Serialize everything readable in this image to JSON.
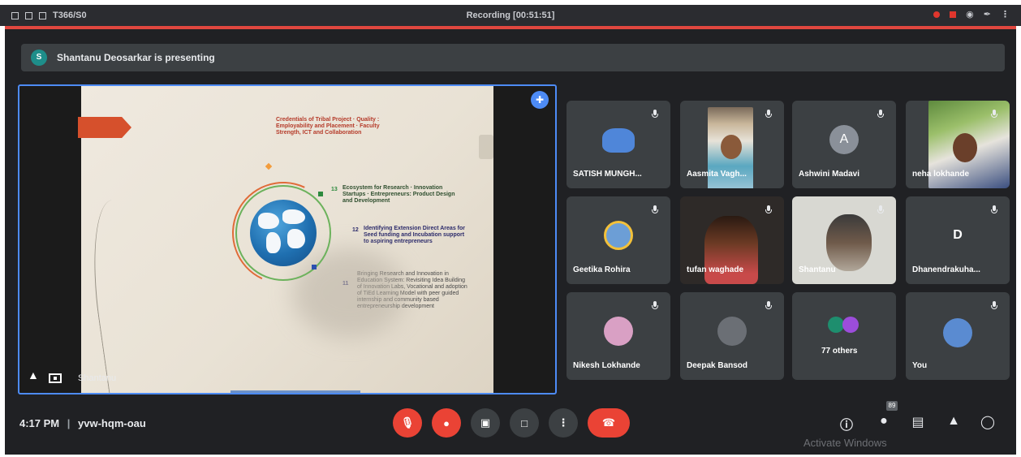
{
  "window": {
    "title": "T366/S0",
    "recording": "Recording [00:51:51]"
  },
  "banner": {
    "avatar_initial": "S",
    "text": "Shantanu Deosarkar is presenting"
  },
  "presentation": {
    "slide": {
      "block1": "Credentials of Tribal Project · Quality : Employability and Placement · Faculty Strength, ICT and Collaboration",
      "block2": "Ecosystem for Research · Innovation Startups · Entrepreneurs: Product Design and Development",
      "block3": "Identifying Extension Direct Areas for Seed funding and Incubation support to aspiring entrepreneurs",
      "block4": "Bringing Research and Innovation in Education System: Revisiting Idea Building of Innovation Labs, Vocational and adoption of TiEd Learning Model with peer guided internship and community based entrepreneurship development",
      "num2": "13",
      "num3": "12",
      "num4": "11"
    },
    "label": "Shantanu",
    "expand_icon": "expand-icon"
  },
  "participants": [
    {
      "name": "SATISH MUNGH...",
      "type": "avatar",
      "color": "#4f86d9"
    },
    {
      "name": "Aasmita Vagh...",
      "type": "video"
    },
    {
      "name": "Ashwini Madavi",
      "type": "initial",
      "initial": "A",
      "color": "#8a9099"
    },
    {
      "name": "neha lokhande",
      "type": "video"
    },
    {
      "name": "Geetika Rohira",
      "type": "avatar",
      "color": "#6c9ed6"
    },
    {
      "name": "tufan waghade",
      "type": "video"
    },
    {
      "name": "Shantanu",
      "type": "video"
    },
    {
      "name": "Dhanendrakuha...",
      "type": "initial",
      "initial": "D",
      "color": "#3c4043"
    },
    {
      "name": "Nikesh Lokhande",
      "type": "avatar",
      "color": "#d9a0c4"
    },
    {
      "name": "Deepak Bansod",
      "type": "avatar",
      "color": "#6b6f75"
    },
    {
      "name": "77 others",
      "type": "others"
    },
    {
      "name": "You",
      "type": "avatar",
      "color": "#5a8bd1"
    }
  ],
  "footer": {
    "time": "4:17 PM",
    "separator": "|",
    "meeting_code": "yvw-hqm-oau",
    "people_count": "89",
    "watermark": "Activate Windows"
  }
}
